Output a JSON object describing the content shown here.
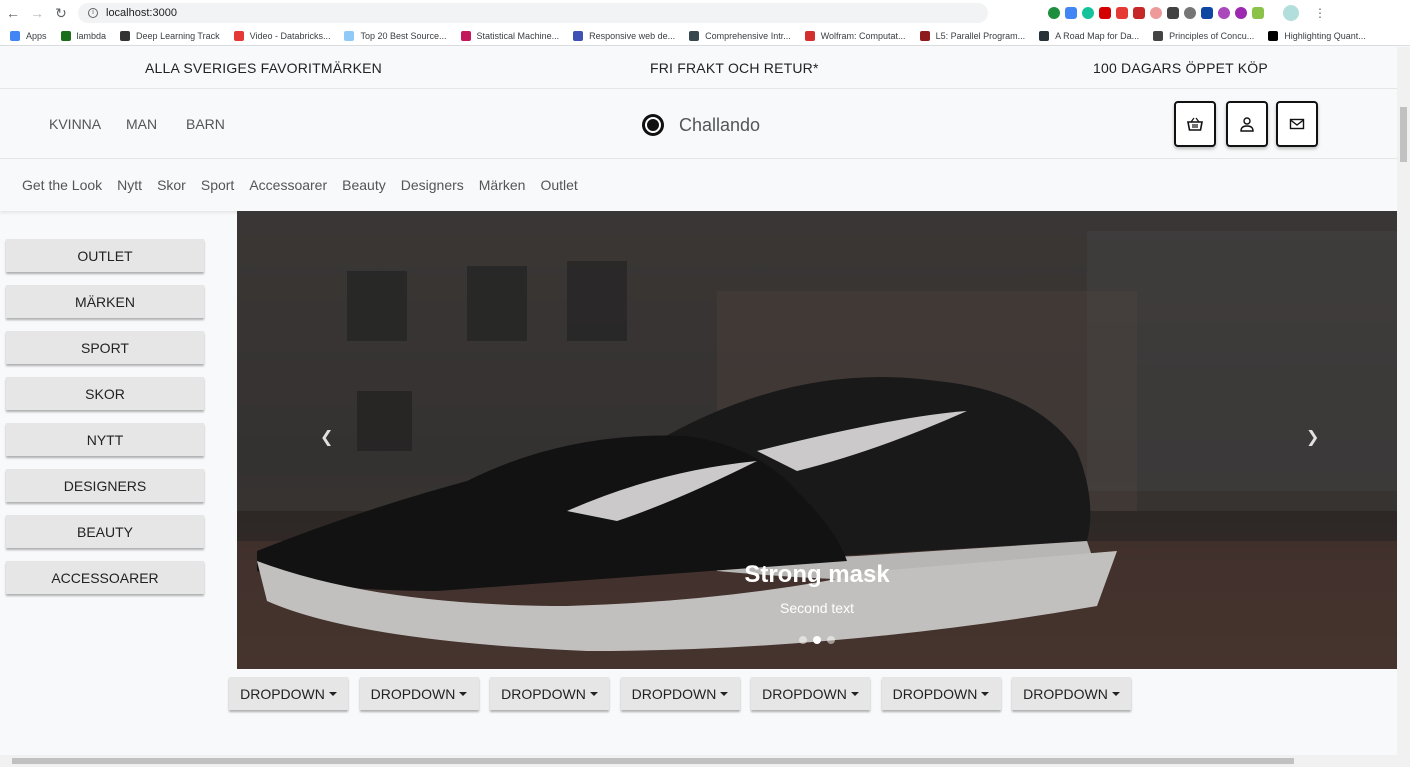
{
  "browser": {
    "url": "localhost:3000",
    "bookmarks": [
      {
        "label": "Apps",
        "color": "#4285f4"
      },
      {
        "label": "lambda",
        "color": "#1a6e1a"
      },
      {
        "label": "Deep Learning Track",
        "color": "#333333"
      },
      {
        "label": "Video - Databricks...",
        "color": "#e53935"
      },
      {
        "label": "Top 20 Best Source...",
        "color": "#90caf9"
      },
      {
        "label": "Statistical Machine...",
        "color": "#c2185b"
      },
      {
        "label": "Responsive web de...",
        "color": "#3f51b5"
      },
      {
        "label": "Comprehensive Intr...",
        "color": "#37474f"
      },
      {
        "label": "Wolfram: Computat...",
        "color": "#d32f2f"
      },
      {
        "label": "L5: Parallel Program...",
        "color": "#8e1b1b"
      },
      {
        "label": "A Road Map for Da...",
        "color": "#263238"
      },
      {
        "label": "Principles of Concu...",
        "color": "#444444"
      },
      {
        "label": "Highlighting Quant...",
        "color": "#000000"
      }
    ]
  },
  "topstrip": {
    "left": "ALLA SVERIGES FAVORITMÄRKEN",
    "center": "FRI FRAKT OCH RETUR*",
    "right": "100 DAGARS ÖPPET KÖP"
  },
  "header": {
    "gender_nav": [
      "KVINNA",
      "MAN",
      "BARN"
    ],
    "brand": "Challando",
    "icons": [
      "basket-icon",
      "user-icon",
      "mail-icon"
    ]
  },
  "category_nav": [
    "Get the Look",
    "Nytt",
    "Skor",
    "Sport",
    "Accessoarer",
    "Beauty",
    "Designers",
    "Märken",
    "Outlet"
  ],
  "sidebar": [
    "OUTLET",
    "MÄRKEN",
    "SPORT",
    "SKOR",
    "NYTT",
    "DESIGNERS",
    "BEAUTY",
    "ACCESSOARER"
  ],
  "carousel": {
    "title": "Strong mask",
    "subtitle": "Second text",
    "slides": 3,
    "active_slide": 2
  },
  "dropdowns": [
    "DROPDOWN",
    "DROPDOWN",
    "DROPDOWN",
    "DROPDOWN",
    "DROPDOWN",
    "DROPDOWN",
    "DROPDOWN"
  ]
}
